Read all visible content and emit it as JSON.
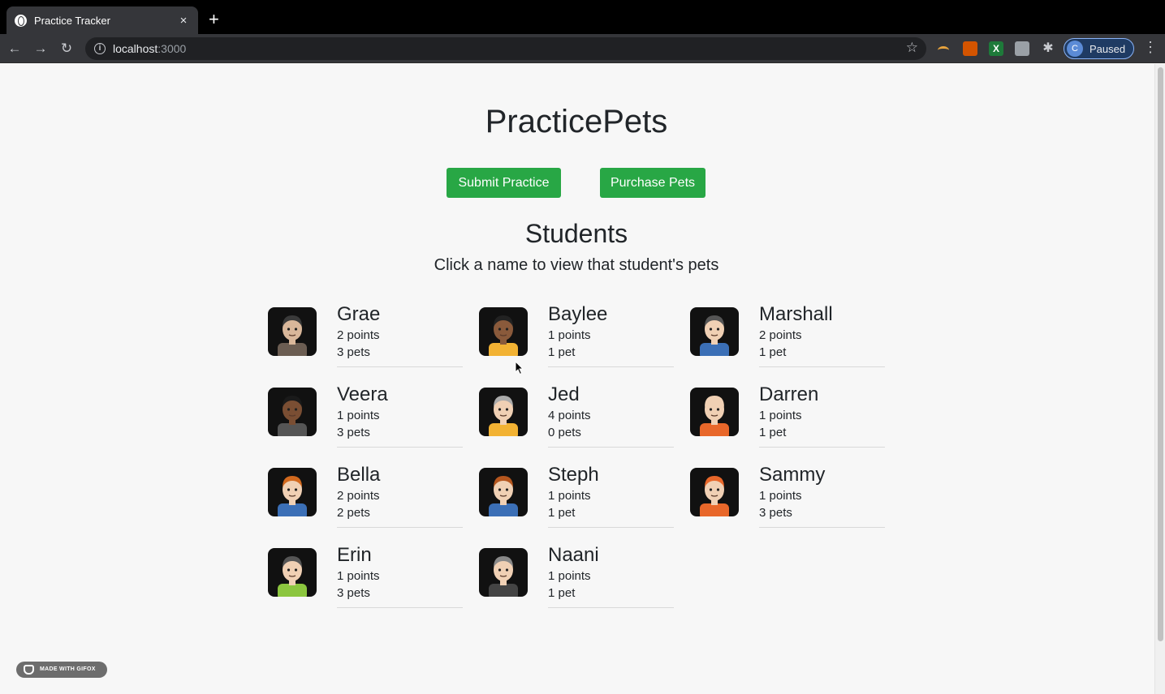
{
  "browser": {
    "tab_title": "Practice Tracker",
    "tab_close": "×",
    "new_tab": "+",
    "url_host": "localhost",
    "url_port": ":3000",
    "back": "←",
    "forward": "→",
    "reload": "↻",
    "star": "☆",
    "ext_x_label": "X",
    "ext_puzzle": "✱",
    "profile_initial": "C",
    "profile_status": "Paused",
    "menu": "⋮"
  },
  "page": {
    "title": "PracticePets",
    "submit_label": "Submit Practice",
    "purchase_label": "Purchase Pets",
    "section_title": "Students",
    "section_subtitle": "Click a name to view that student's pets"
  },
  "students": [
    {
      "name": "Grae",
      "points": "2 points",
      "pets": "3 pets",
      "skin": "#d9b79a",
      "hair": "#3a3a3a",
      "shirt": "#6b5d52"
    },
    {
      "name": "Baylee",
      "points": "1 points",
      "pets": "1 pet",
      "skin": "#8a5a3b",
      "hair": "#222222",
      "shirt": "#f2b233"
    },
    {
      "name": "Marshall",
      "points": "2 points",
      "pets": "1 pet",
      "skin": "#f0d0b4",
      "hair": "#555555",
      "shirt": "#3b6fb6"
    },
    {
      "name": "Veera",
      "points": "1 points",
      "pets": "3 pets",
      "skin": "#7a4e33",
      "hair": "#1a1a1a",
      "shirt": "#555555"
    },
    {
      "name": "Jed",
      "points": "4 points",
      "pets": "0 pets",
      "skin": "#f0d0b4",
      "hair": "#aaaaaa",
      "shirt": "#f2b233"
    },
    {
      "name": "Darren",
      "points": "1 points",
      "pets": "1 pet",
      "skin": "#f0d0b4",
      "hair": "#f0d0b4",
      "shirt": "#e8672a"
    },
    {
      "name": "Bella",
      "points": "2 points",
      "pets": "2 pets",
      "skin": "#f0d0b4",
      "hair": "#d2691e",
      "shirt": "#3b6fb6"
    },
    {
      "name": "Steph",
      "points": "1 points",
      "pets": "1 pet",
      "skin": "#f0d0b4",
      "hair": "#b5561e",
      "shirt": "#3b6fb6"
    },
    {
      "name": "Sammy",
      "points": "1 points",
      "pets": "3 pets",
      "skin": "#f0d0b4",
      "hair": "#e8672a",
      "shirt": "#e8672a"
    },
    {
      "name": "Erin",
      "points": "1 points",
      "pets": "3 pets",
      "skin": "#f0d0b4",
      "hair": "#555555",
      "shirt": "#8cc63f"
    },
    {
      "name": "Naani",
      "points": "1 points",
      "pets": "1 pet",
      "skin": "#f0d0b4",
      "hair": "#888888",
      "shirt": "#444444"
    }
  ],
  "watermark": "MADE WITH GIFOX",
  "colors": {
    "accent": "#28a745",
    "text": "#212529"
  }
}
